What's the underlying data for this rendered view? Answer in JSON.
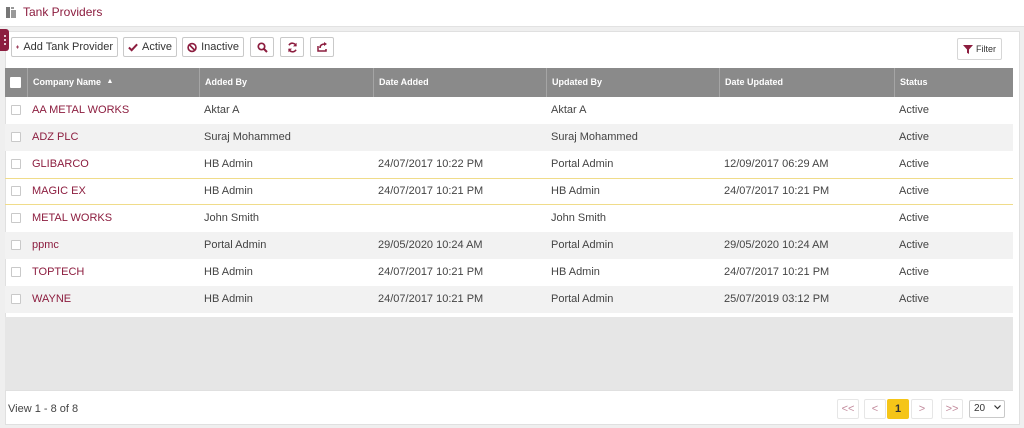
{
  "page": {
    "title": "Tank Providers"
  },
  "toolbar": {
    "add_label": "Add Tank Provider",
    "active_label": "Active",
    "inactive_label": "Inactive",
    "filter_label": "Filter"
  },
  "table": {
    "columns": [
      "Company Name",
      "Added By",
      "Date Added",
      "Updated By",
      "Date Updated",
      "Status"
    ],
    "rows": [
      {
        "company": "AA METAL WORKS",
        "added_by": "Aktar A",
        "date_added": "",
        "updated_by": "Aktar A",
        "date_updated": "",
        "status": "Active"
      },
      {
        "company": "ADZ PLC",
        "added_by": "Suraj Mohammed",
        "date_added": "",
        "updated_by": "Suraj Mohammed",
        "date_updated": "",
        "status": "Active"
      },
      {
        "company": "GLIBARCO",
        "added_by": "HB Admin",
        "date_added": "24/07/2017 10:22 PM",
        "updated_by": "Portal Admin",
        "date_updated": "12/09/2017 06:29 AM",
        "status": "Active"
      },
      {
        "company": "MAGIC EX",
        "added_by": "HB Admin",
        "date_added": "24/07/2017 10:21 PM",
        "updated_by": "HB Admin",
        "date_updated": "24/07/2017 10:21 PM",
        "status": "Active"
      },
      {
        "company": "METAL WORKS",
        "added_by": "John Smith",
        "date_added": "",
        "updated_by": "John Smith",
        "date_updated": "",
        "status": "Active"
      },
      {
        "company": "ppmc",
        "added_by": "Portal Admin",
        "date_added": "29/05/2020 10:24 AM",
        "updated_by": "Portal Admin",
        "date_updated": "29/05/2020 10:24 AM",
        "status": "Active"
      },
      {
        "company": "TOPTECH",
        "added_by": "HB Admin",
        "date_added": "24/07/2017 10:21 PM",
        "updated_by": "HB Admin",
        "date_updated": "24/07/2017 10:21 PM",
        "status": "Active"
      },
      {
        "company": "WAYNE",
        "added_by": "HB Admin",
        "date_added": "24/07/2017 10:21 PM",
        "updated_by": "Portal Admin",
        "date_updated": "25/07/2019 03:12 PM",
        "status": "Active"
      }
    ]
  },
  "pager": {
    "view_text": "View 1 - 8 of 8",
    "first": "<<",
    "prev": "<",
    "current_page": "1",
    "next": ">",
    "last": ">>",
    "page_size": "20"
  },
  "colors": {
    "brand": "#8c1d3f",
    "header_bg": "#8a8a8a",
    "active_page": "#f5c518"
  },
  "icons": [
    "tank-icon",
    "plus-icon",
    "check-icon",
    "ban-icon",
    "search-icon",
    "refresh-icon",
    "export-icon",
    "filter-icon",
    "kebab-icon"
  ]
}
